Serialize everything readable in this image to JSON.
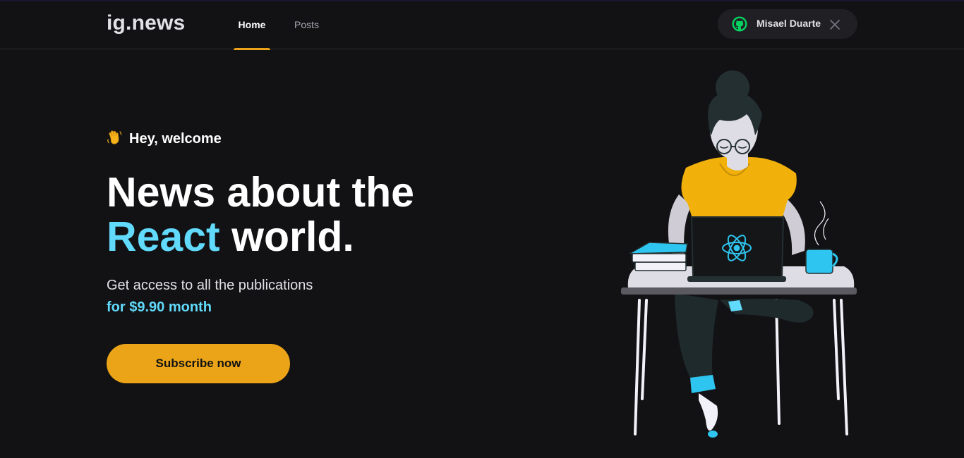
{
  "header": {
    "logo": "ig.news",
    "nav": [
      {
        "label": "Home",
        "active": true
      },
      {
        "label": "Posts",
        "active": false
      }
    ],
    "user": {
      "name": "Misael Duarte",
      "icon": "github-icon",
      "close_icon": "close-icon"
    }
  },
  "hero": {
    "greeting_icon": "waving-hand-icon",
    "greeting": "Hey, welcome",
    "headline_line1": "News about the",
    "headline_highlight": "React",
    "headline_rest": "world.",
    "subtitle": "Get access to all the publications",
    "price": "for $9.90 month",
    "cta_label": "Subscribe now"
  },
  "illustration": {
    "description_icon": "woman-with-laptop-illustration",
    "laptop_logo": "react-logo-icon"
  },
  "colors": {
    "background": "#121214",
    "accent_yellow": "#eba417",
    "accent_cyan": "#61dafb",
    "text": "#e1e1e6"
  }
}
